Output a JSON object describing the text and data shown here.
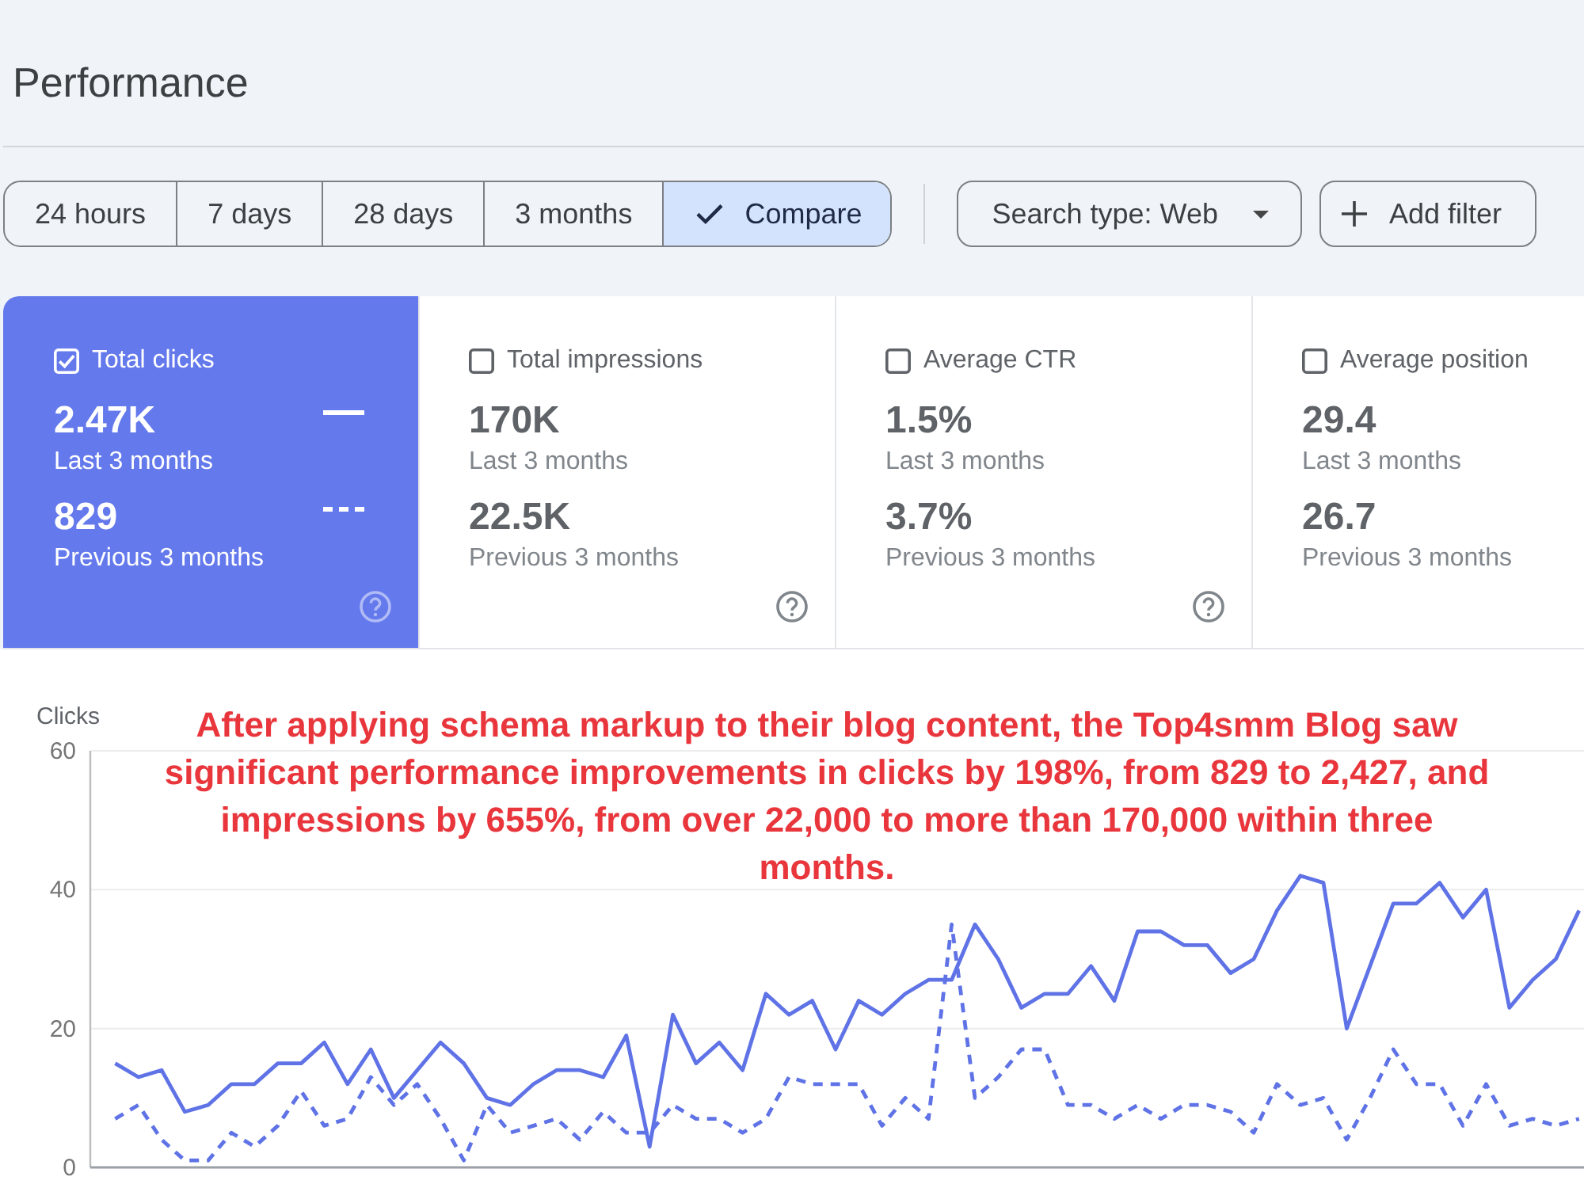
{
  "page": {
    "title": "Performance"
  },
  "date_range": [
    {
      "label": "24 hours",
      "selected": false
    },
    {
      "label": "7 days",
      "selected": false
    },
    {
      "label": "28 days",
      "selected": false
    },
    {
      "label": "3 months",
      "selected": false
    },
    {
      "label": "Compare",
      "selected": true
    }
  ],
  "filters": [
    {
      "kind": "dropdown",
      "label": "Search type: Web"
    },
    {
      "kind": "add",
      "label": "Add filter"
    }
  ],
  "metrics": [
    {
      "label": "Total clicks",
      "checked": true,
      "value": "2.47K",
      "period": "Last 3 months",
      "previous_value": "829",
      "previous_period": "Previous 3 months",
      "help": true
    },
    {
      "label": "Total impressions",
      "checked": false,
      "value": "170K",
      "period": "Last 3 months",
      "previous_value": "22.5K",
      "previous_period": "Previous 3 months",
      "help": true
    },
    {
      "label": "Average CTR",
      "checked": false,
      "value": "1.5%",
      "period": "Last 3 months",
      "previous_value": "3.7%",
      "previous_period": "Previous 3 months",
      "help": true
    },
    {
      "label": "Average position",
      "checked": false,
      "value": "29.4",
      "period": "Last 3 months",
      "previous_value": "26.7",
      "previous_period": "Previous 3 months",
      "help": false
    }
  ],
  "chart": {
    "chart_data": [
      {
        "type": "line",
        "ylabel": "Clicks",
        "ylim": [
          0,
          60
        ],
        "yticks": [
          0,
          20,
          40,
          60
        ],
        "grid": true,
        "series": [
          {
            "color": "#5f73e6",
            "line_style": "solid",
            "values": [
              15,
              13,
              14,
              8,
              9,
              12,
              12,
              15,
              15,
              18,
              12,
              17,
              10,
              14,
              18,
              15,
              10,
              9,
              12,
              14,
              14,
              13,
              19,
              3,
              22,
              15,
              18,
              14,
              25,
              22,
              24,
              17,
              24,
              22,
              25,
              27,
              27,
              35,
              30,
              23,
              25,
              25,
              29,
              24,
              34,
              34,
              32,
              32,
              28,
              30,
              37,
              42,
              41,
              20,
              29,
              38,
              38,
              41,
              36,
              40,
              23,
              27,
              30,
              37
            ]
          },
          {
            "color": "#5f73e6",
            "line_style": "dashed",
            "values": [
              7,
              9,
              4,
              1,
              1,
              5,
              3,
              6,
              11,
              6,
              7,
              13,
              9,
              12,
              7,
              1,
              9,
              5,
              6,
              7,
              4,
              8,
              5,
              5,
              9,
              7,
              7,
              5,
              7,
              13,
              12,
              12,
              12,
              6,
              10,
              7,
              35,
              10,
              13,
              17,
              17,
              9,
              9,
              7,
              9,
              7,
              9,
              9,
              8,
              5,
              12,
              9,
              10,
              4,
              10,
              17,
              12,
              12,
              6,
              12,
              6,
              7,
              6,
              7
            ]
          }
        ],
        "annotations": [
          "After applying schema markup to their blog content, the Top4smm Blog saw significant performance improvements in clicks by 198%, from 829 to 2,427, and impressions by 655%, from over 22,000 to more than 170,000 within three months."
        ]
      }
    ]
  }
}
